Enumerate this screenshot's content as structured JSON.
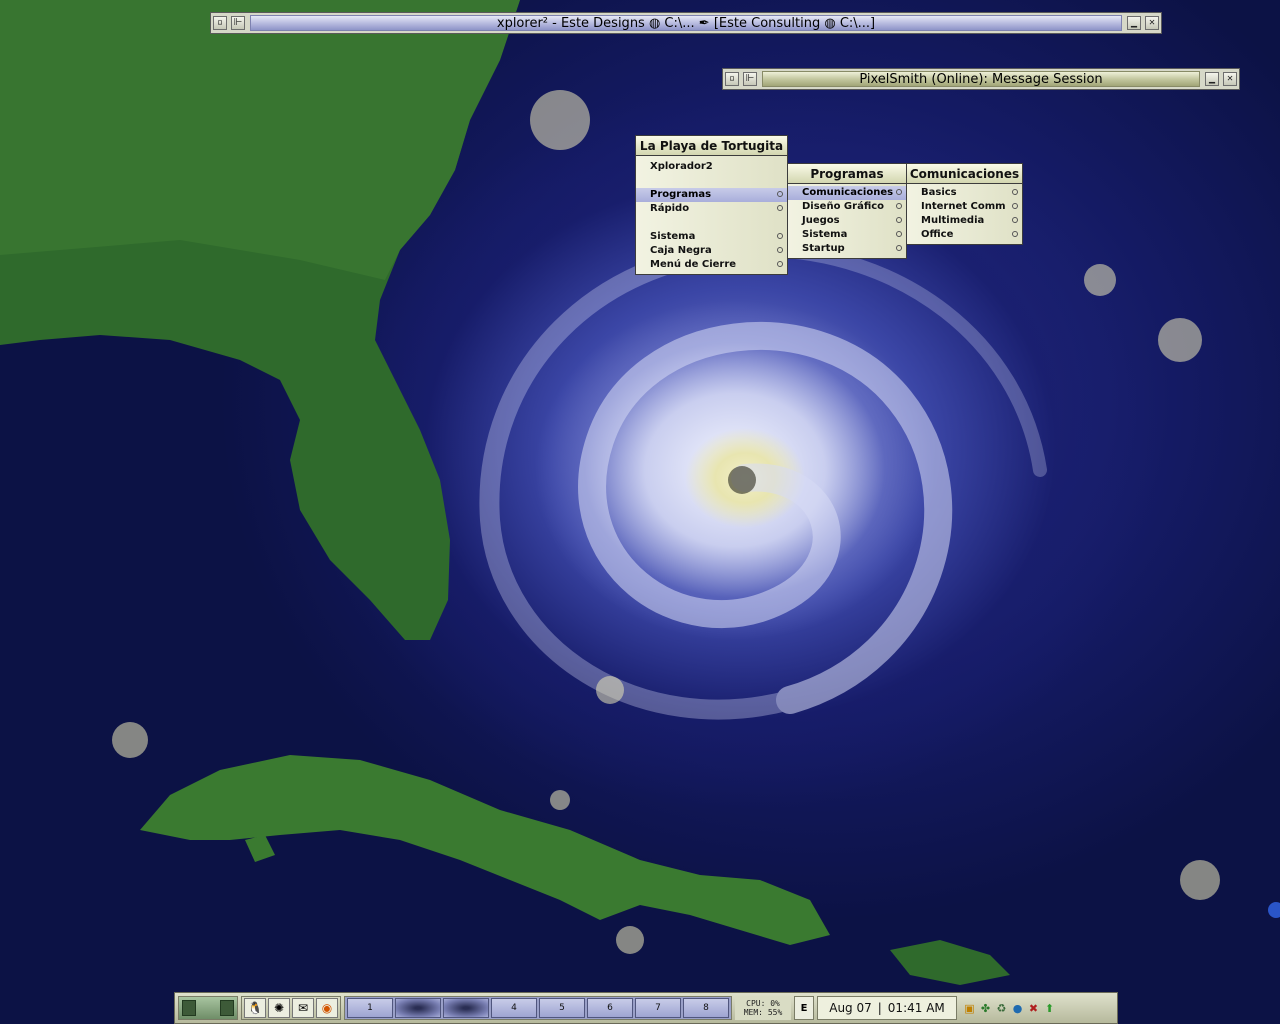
{
  "windows": [
    {
      "title": "xplorer² - Este Designs ◍ C:\\... ✒ [Este Consulting ◍ C:\\...]"
    },
    {
      "title": "PixelSmith (Online): Message Session"
    }
  ],
  "menus": {
    "main": {
      "title": "La Playa de Tortugita",
      "items": [
        "Xplorador2",
        "Programas",
        "Rápido",
        "Sistema",
        "Caja Negra",
        "Menú de Cierre"
      ]
    },
    "programas": {
      "title": "Programas",
      "items": [
        "Comunicaciones",
        "Diseño Gráfico",
        "Juegos",
        "Sistema",
        "Startup"
      ]
    },
    "comunicaciones": {
      "title": "Comunicaciones",
      "items": [
        "Basics",
        "Internet Comm",
        "Multimedia",
        "Office"
      ]
    }
  },
  "taskbar": {
    "desktops": [
      "1",
      "2",
      "3",
      "4",
      "5",
      "6",
      "7",
      "8"
    ],
    "cpu": "CPU: 0%",
    "mem": "MEM: 55%",
    "e_label": "E",
    "date": "Aug 07",
    "time": "01:41 AM"
  },
  "colors": {
    "menu_bg": "#e9ead6",
    "menu_selected": "#b7bce2",
    "win1_title": "#b9bde0",
    "win2_title": "#c4c8a0"
  }
}
